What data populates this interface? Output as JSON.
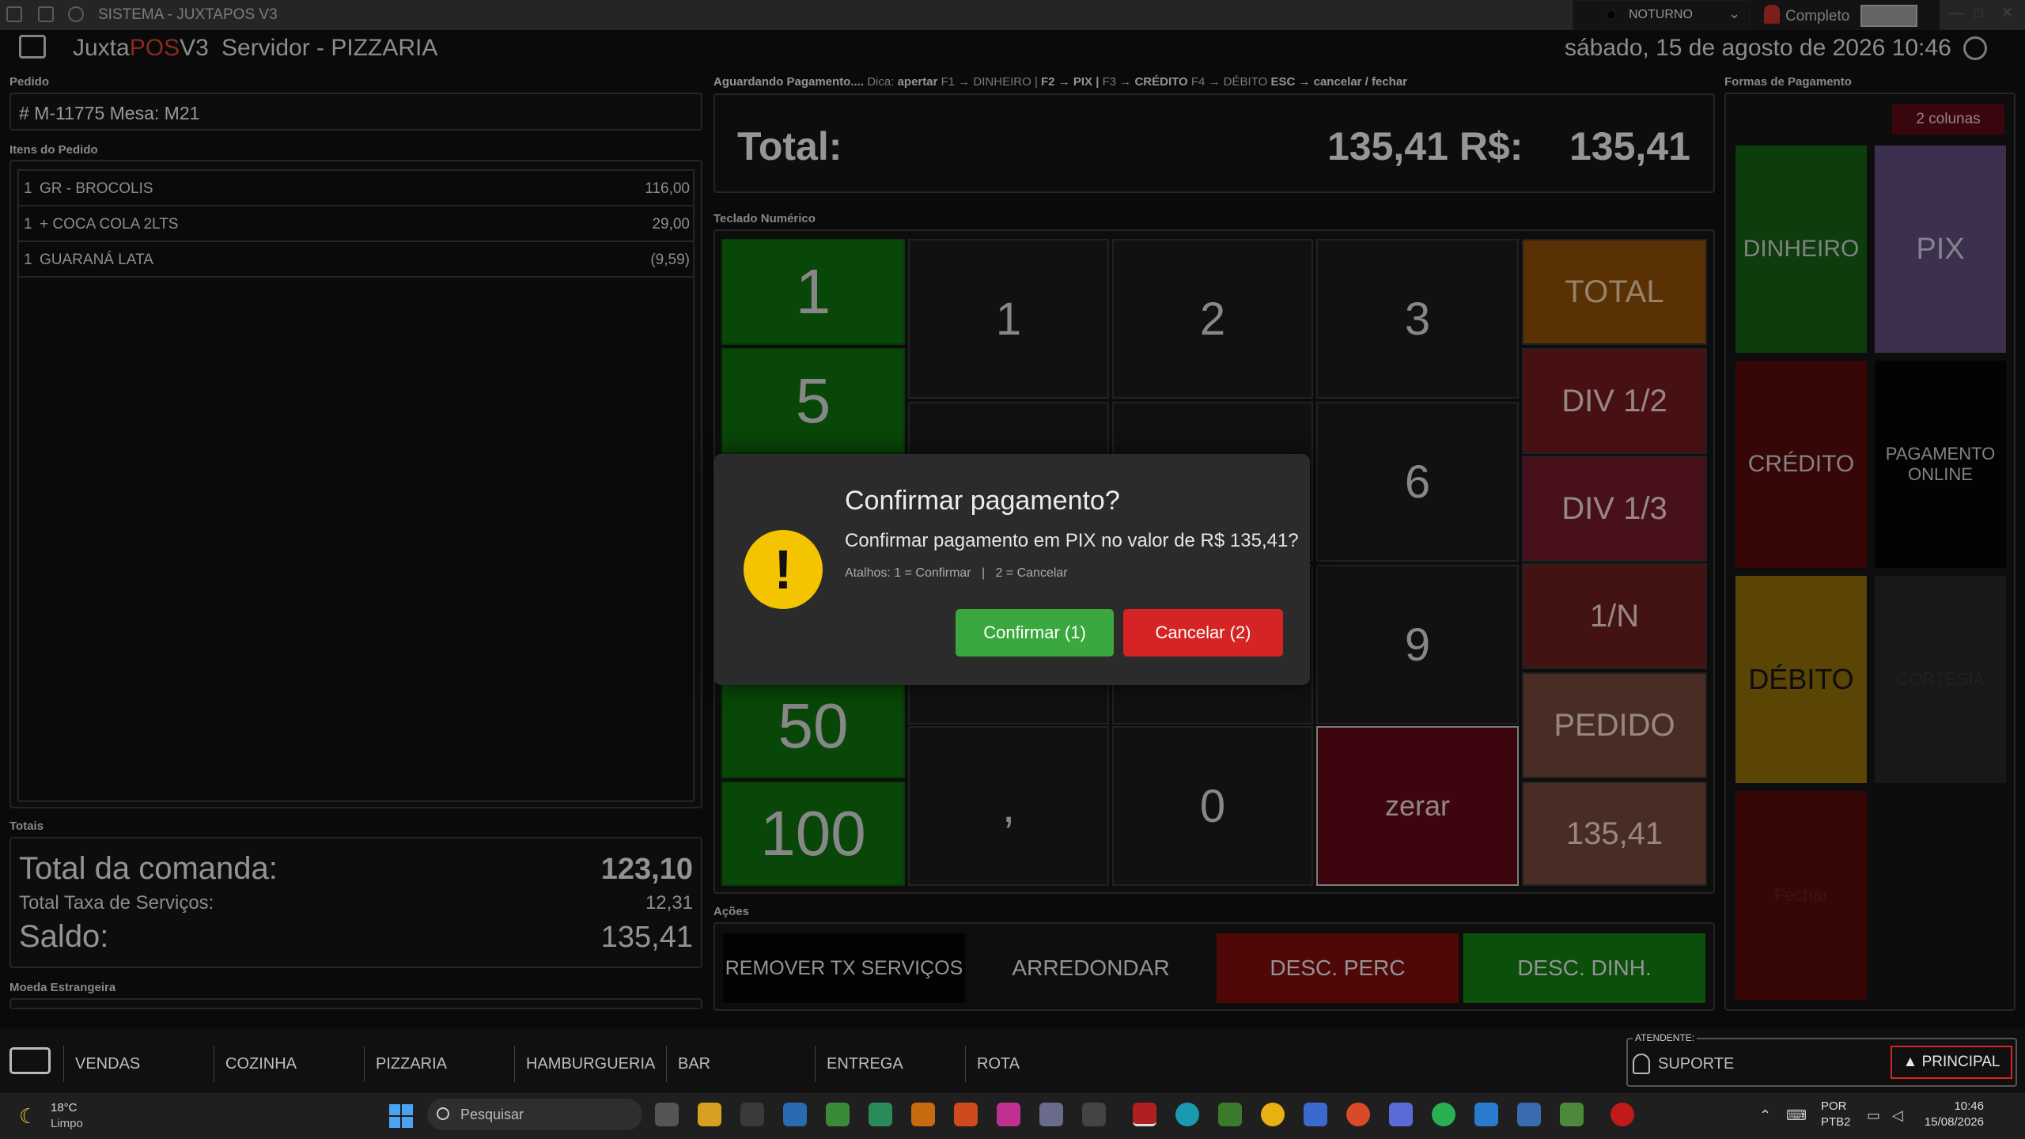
{
  "window": {
    "title": "SISTEMA - JUXTAPOS V3",
    "theme": "NOTURNO",
    "mode": "Completo"
  },
  "header": {
    "app_name_a": "Juxta",
    "app_name_b": "POS",
    "app_name_c": "V3",
    "server": "Servidor - PIZZARIA",
    "datetime": "sábado, 15 de agosto de 2026 10:46"
  },
  "order": {
    "section_label": "Pedido",
    "id_label": "# M-11775 Mesa: M21",
    "items_label": "Itens do Pedido",
    "items": [
      {
        "qty": "1",
        "name": "GR -  BROCOLIS",
        "value": "116,00"
      },
      {
        "qty": "1",
        "name": "+ COCA COLA 2LTS",
        "value": "29,00"
      },
      {
        "qty": "1",
        "name": "GUARANÁ LATA",
        "value": "(9,59)"
      }
    ]
  },
  "totals": {
    "section_label": "Totais",
    "comanda_label": "Total da comanda:",
    "comanda_value": "123,10",
    "taxa_label": "Total Taxa de Serviços:",
    "taxa_value": "12,31",
    "saldo_label": "Saldo:",
    "saldo_value": "135,41",
    "foreign_label": "Moeda Estrangeira"
  },
  "payment": {
    "hint_prefix": "Aguardando Pagamento....",
    "hint_dica": "Dica:",
    "hint_apertar": "apertar",
    "hint_f1": "F1 → DINHEIRO |",
    "hint_f2": "F2 → PIX |",
    "hint_f3": "F3 →",
    "hint_credito": "CRÉDITO",
    "hint_f4": "F4 → DÉBITO",
    "hint_esc": "ESC → cancelar / fechar",
    "total_label": "Total:",
    "total_mid": "135,41 R$:",
    "total_value": "135,41"
  },
  "keypad": {
    "label": "Teclado Numérico",
    "quick": [
      "1",
      "5",
      "50",
      "100"
    ],
    "digits": [
      "1",
      "2",
      "3",
      "6",
      "9",
      ",",
      "0"
    ],
    "zerar": "zerar",
    "right": [
      "TOTAL",
      "DIV 1/2",
      "DIV 1/3",
      "1/N",
      "PEDIDO",
      "135,41"
    ]
  },
  "actions": {
    "label": "Ações",
    "buttons": [
      "REMOVER TX SERVIÇOS",
      "ARREDONDAR",
      "DESC. PERC",
      "DESC. DINH."
    ]
  },
  "payment_methods": {
    "label": "Formas de Pagamento",
    "columns_badge": "2 colunas",
    "methods": [
      "DINHEIRO",
      "PIX",
      "CRÉDITO",
      "PAGAMENTO ONLINE",
      "DÉBITO",
      "CORTESIA",
      "Fechar"
    ]
  },
  "modal": {
    "title": "Confirmar pagamento?",
    "message": "Confirmar pagamento em PIX no valor de R$ 135,41?",
    "hint": "Atalhos: 1 = Confirmar   |   2 = Cancelar",
    "confirm": "Confirmar (1)",
    "cancel": "Cancelar (2)"
  },
  "nav": {
    "tabs": [
      "VENDAS",
      "COZINHA",
      "PIZZARIA",
      "HAMBURGUERIA",
      "BAR",
      "ENTREGA",
      "ROTA"
    ]
  },
  "attendant": {
    "legend": "ATENDENTE:",
    "name": "SUPORTE",
    "principal": "PRINCIPAL"
  },
  "taskbar": {
    "weather_temp": "18°C",
    "weather_desc": "Limpo",
    "search_placeholder": "Pesquisar",
    "lang1": "POR",
    "lang2": "PTB2",
    "time": "10:46",
    "date": "15/08/2026"
  }
}
